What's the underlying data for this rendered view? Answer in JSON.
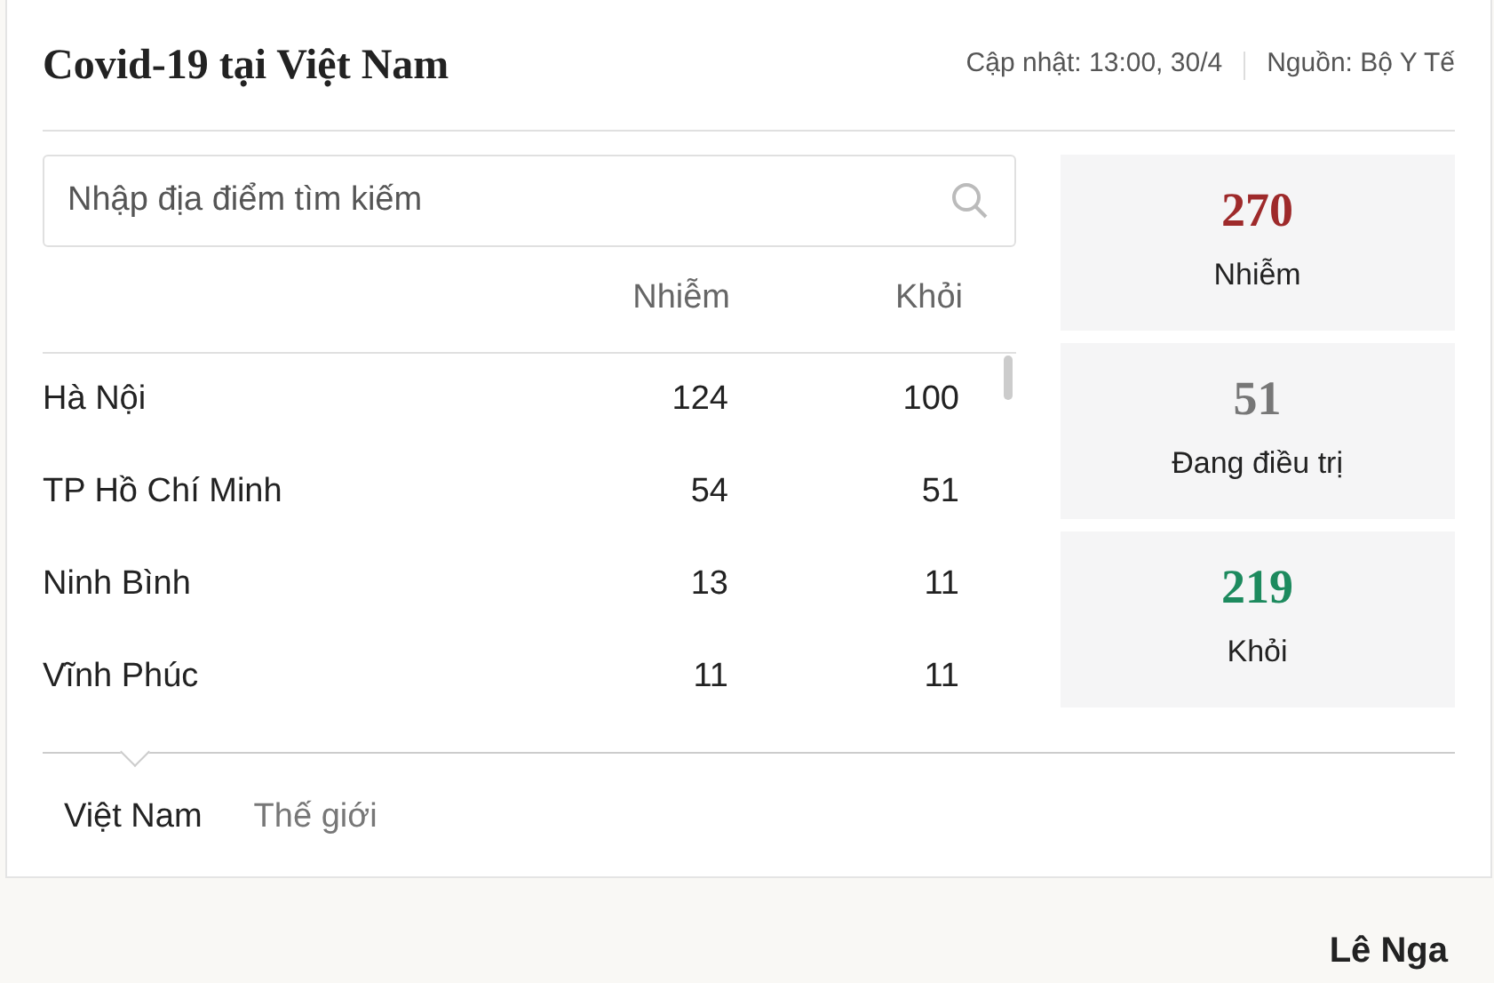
{
  "widget": {
    "title": "Covid-19 tại Việt Nam",
    "updated": "Cập nhật: 13:00, 30/4",
    "source": "Nguồn: Bộ Y Tế"
  },
  "search": {
    "placeholder": "Nhập địa điểm tìm kiếm"
  },
  "table": {
    "columns": [
      "Nhiễm",
      "Khỏi"
    ],
    "rows": [
      {
        "place": "Hà Nội",
        "infected": "124",
        "recovered": "100"
      },
      {
        "place": "TP Hồ Chí Minh",
        "infected": "54",
        "recovered": "51"
      },
      {
        "place": "Ninh Bình",
        "infected": "13",
        "recovered": "11"
      },
      {
        "place": "Vĩnh Phúc",
        "infected": "11",
        "recovered": "11"
      }
    ]
  },
  "stats": [
    {
      "value": "270",
      "label": "Nhiễm",
      "color": "#9e2a2b"
    },
    {
      "value": "51",
      "label": "Đang điều trị",
      "color": "#777777"
    },
    {
      "value": "219",
      "label": "Khỏi",
      "color": "#1d8a5e"
    }
  ],
  "tabs": [
    {
      "label": "Việt Nam",
      "selected": true
    },
    {
      "label": "Thế giới",
      "selected": false
    }
  ],
  "author": "Lê Nga"
}
